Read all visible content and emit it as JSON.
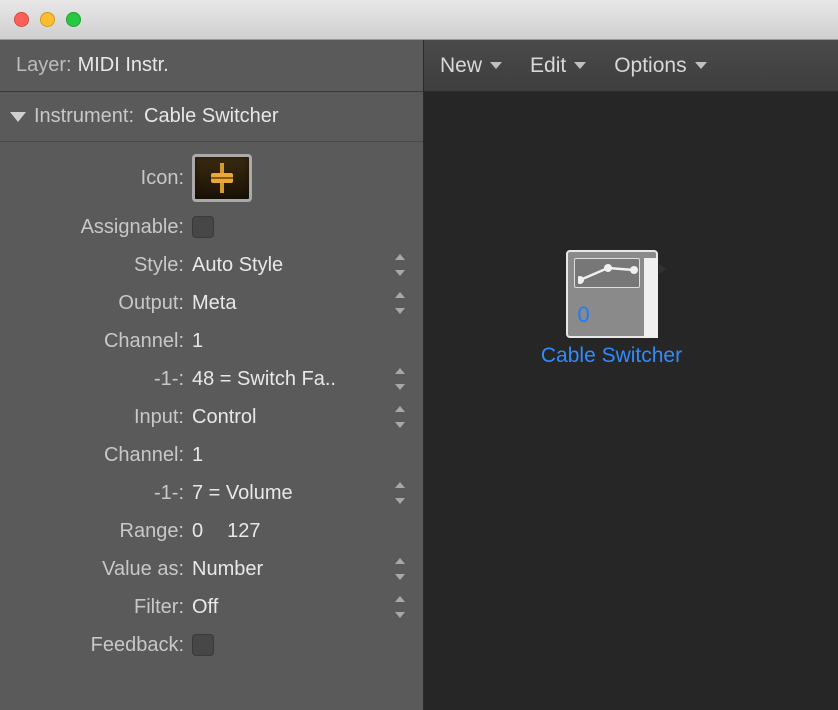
{
  "layer": {
    "label": "Layer:",
    "value": "MIDI Instr."
  },
  "section": {
    "label": "Instrument:",
    "value": "Cable Switcher"
  },
  "rows": {
    "icon_label": "Icon:",
    "assignable_label": "Assignable:",
    "style": {
      "label": "Style:",
      "value": "Auto Style"
    },
    "output": {
      "label": "Output:",
      "value": "Meta"
    },
    "channel1": {
      "label": "Channel:",
      "value": "1"
    },
    "minus1a": {
      "label": "-1-:",
      "value": "48 = Switch Fa.."
    },
    "input": {
      "label": "Input:",
      "value": "Control"
    },
    "channel2": {
      "label": "Channel:",
      "value": "1"
    },
    "minus1b": {
      "label": "-1-:",
      "value": "7 = Volume"
    },
    "range": {
      "label": "Range:",
      "min": "0",
      "max": "127"
    },
    "valueas": {
      "label": "Value as:",
      "value": "Number"
    },
    "filter": {
      "label": "Filter:",
      "value": "Off"
    },
    "feedback_label": "Feedback:"
  },
  "toolbar": {
    "new": "New",
    "edit": "Edit",
    "options": "Options"
  },
  "node": {
    "label": "Cable Switcher",
    "badge": "0"
  }
}
